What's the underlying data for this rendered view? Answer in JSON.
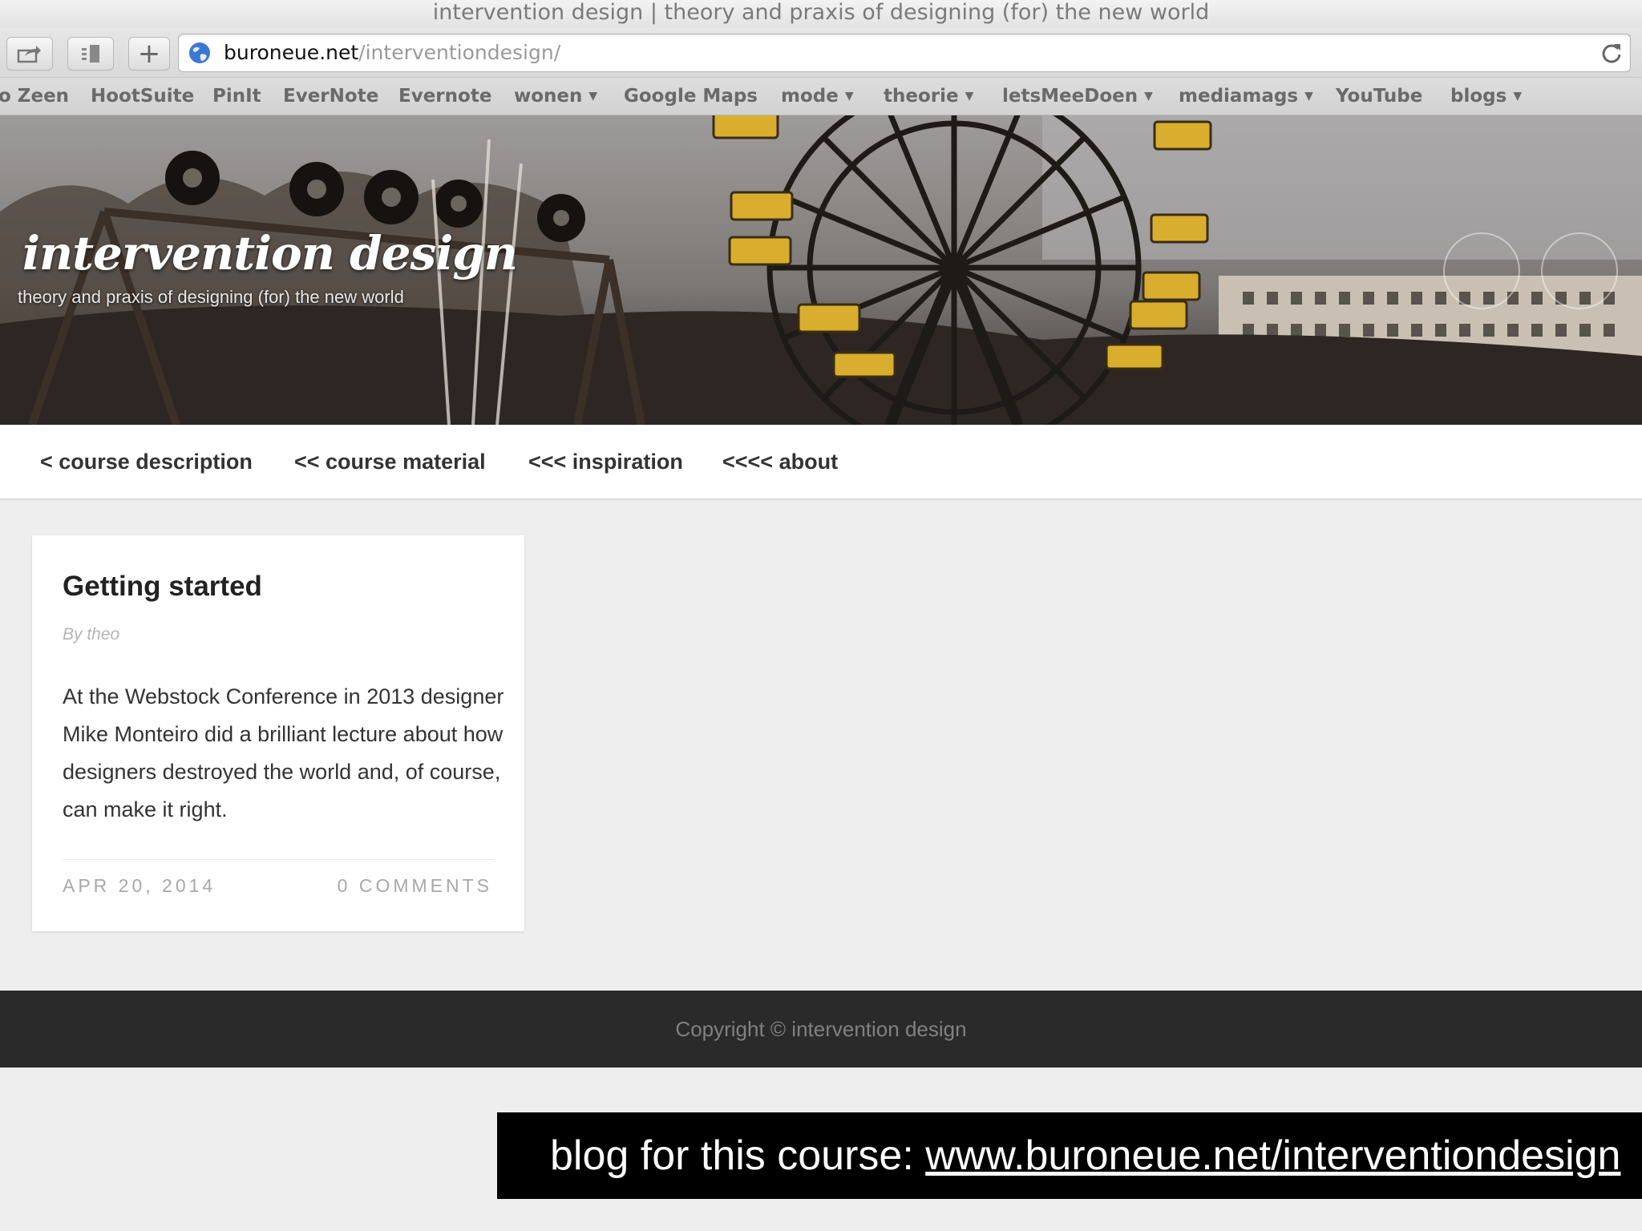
{
  "window": {
    "title": "intervention design | theory and praxis of designing (for) the new world"
  },
  "toolbar": {
    "share_icon": "share-icon",
    "reader_icon": "reader-icon",
    "add_icon": "plus-icon",
    "add_label": "+",
    "url_host": "buroneue.net",
    "url_path": "/interventiondesign/",
    "reload_icon": "reload-icon"
  },
  "bookmarks": [
    {
      "label": "o Zeen",
      "has_menu": false
    },
    {
      "label": "HootSuite",
      "has_menu": false
    },
    {
      "label": "PinIt",
      "has_menu": false
    },
    {
      "label": "EverNote",
      "has_menu": false
    },
    {
      "label": "Evernote",
      "has_menu": false
    },
    {
      "label": "wonen",
      "has_menu": true
    },
    {
      "label": "Google Maps",
      "has_menu": false
    },
    {
      "label": "mode",
      "has_menu": true
    },
    {
      "label": "theorie",
      "has_menu": true
    },
    {
      "label": "letsMeeDoen",
      "has_menu": true
    },
    {
      "label": "mediamags",
      "has_menu": true
    },
    {
      "label": "YouTube",
      "has_menu": false
    },
    {
      "label": "blogs",
      "has_menu": true
    }
  ],
  "site": {
    "title": "intervention design",
    "tagline": "theory and praxis of designing (for) the new world"
  },
  "nav": [
    {
      "label": "< course description"
    },
    {
      "label": "<< course material"
    },
    {
      "label": "<<< inspiration"
    },
    {
      "label": "<<<< about"
    }
  ],
  "post": {
    "title": "Getting started",
    "author": "By theo",
    "excerpt": "At the Webstock Conference in 2013 designer Mike Monteiro did a brilliant lecture about how designers destroyed the world and, of course, can make it right.",
    "date": "APR 20, 2014",
    "comments": "0 COMMENTS"
  },
  "footer": {
    "copyright": "Copyright © intervention design"
  },
  "caption": {
    "prefix": "blog for this course: ",
    "link": "www.buroneue.net/interventiondesign"
  },
  "colors": {
    "page_bg": "#efeeef",
    "footer_bg": "#2a2a2a",
    "caption_bg": "#000000"
  }
}
